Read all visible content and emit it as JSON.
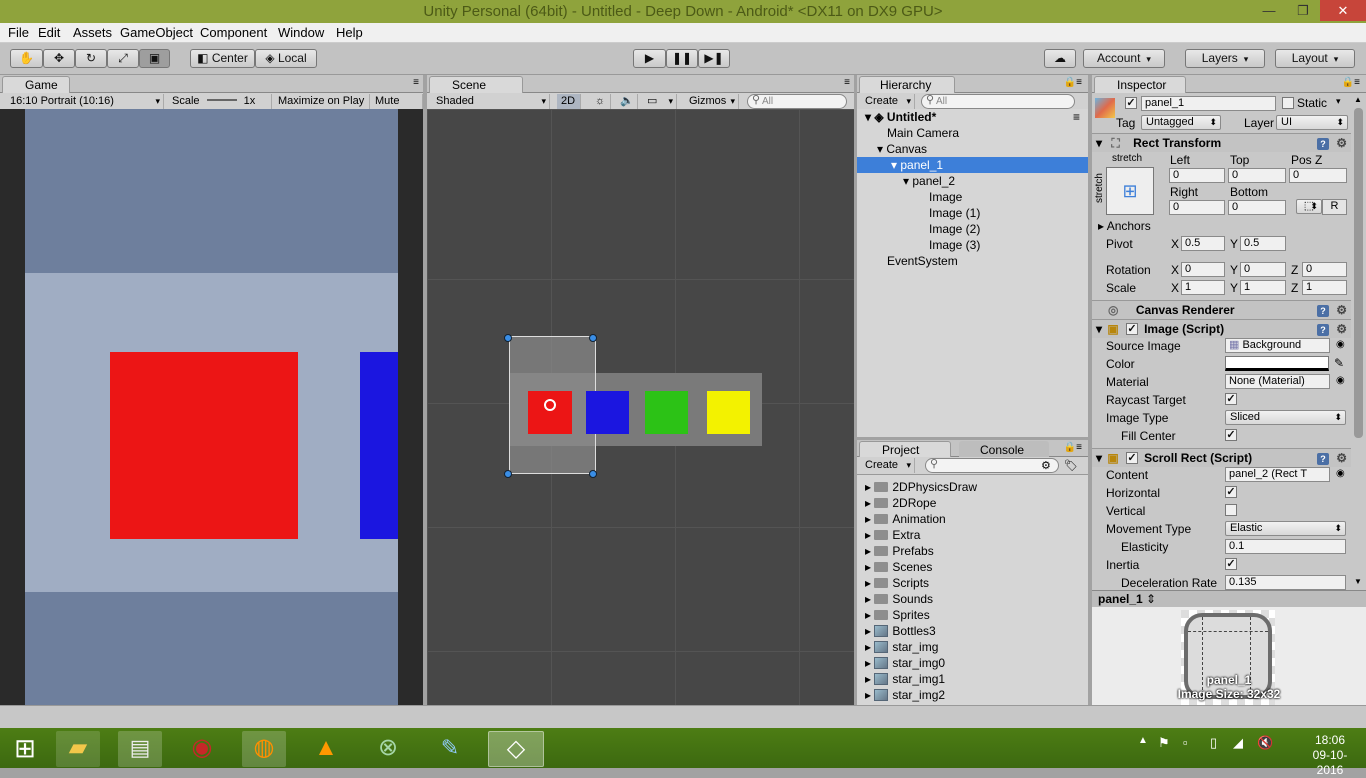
{
  "window": {
    "title": "Unity Personal (64bit) - Untitled - Deep Down - Android* <DX11 on DX9 GPU>",
    "minimize": "—",
    "restore": "❐",
    "close": "✕"
  },
  "menu": [
    "File",
    "Edit",
    "Assets",
    "GameObject",
    "Component",
    "Window",
    "Help"
  ],
  "toolbar": {
    "center": "Center",
    "local": "Local",
    "account": "Account",
    "layers": "Layers",
    "layout": "Layout"
  },
  "game": {
    "tab": "Game",
    "aspect": "16:10 Portrait (10:16)",
    "scale_label": "Scale",
    "scale_value": "1x",
    "maximize": "Maximize on Play",
    "mute": "Mute aud"
  },
  "scene": {
    "tab": "Scene",
    "shading": "Shaded",
    "mode_2d": "2D",
    "gizmos": "Gizmos",
    "search_placeholder": "All"
  },
  "hierarchy": {
    "tab": "Hierarchy",
    "create": "Create",
    "search_placeholder": "All",
    "scene_name": "Untitled*",
    "items": [
      {
        "label": "Main Camera",
        "indent": 0
      },
      {
        "label": "Canvas",
        "indent": 0
      },
      {
        "label": "panel_1",
        "indent": 1,
        "selected": true
      },
      {
        "label": "panel_2",
        "indent": 2
      },
      {
        "label": "Image",
        "indent": 3
      },
      {
        "label": "Image (1)",
        "indent": 3
      },
      {
        "label": "Image (2)",
        "indent": 3
      },
      {
        "label": "Image (3)",
        "indent": 3
      },
      {
        "label": "EventSystem",
        "indent": 0
      }
    ]
  },
  "project": {
    "tab": "Project",
    "console_tab": "Console",
    "create": "Create",
    "folders": [
      "2DPhysicsDraw",
      "2DRope",
      "Animation",
      "Extra",
      "Prefabs",
      "Scenes",
      "Scripts",
      "Sounds",
      "Sprites"
    ],
    "assets": [
      "Bottles3",
      "star_img",
      "star_img0",
      "star_img1",
      "star_img2"
    ]
  },
  "inspector": {
    "tab": "Inspector",
    "object_name": "panel_1",
    "static_label": "Static",
    "tag_label": "Tag",
    "tag_value": "Untagged",
    "layer_label": "Layer",
    "layer_value": "UI",
    "rect_transform": {
      "title": "Rect Transform",
      "stretch": "stretch",
      "left_label": "Left",
      "top_label": "Top",
      "posz_label": "Pos Z",
      "left": "0",
      "top": "0",
      "posz": "0",
      "right_label": "Right",
      "bottom_label": "Bottom",
      "right": "0",
      "bottom": "0",
      "r_button": "R",
      "anchors": "Anchors",
      "pivot_label": "Pivot",
      "pivot_x": "0.5",
      "pivot_y": "0.5",
      "rotation_label": "Rotation",
      "rot_x": "0",
      "rot_y": "0",
      "rot_z": "0",
      "scale_label": "Scale",
      "scale_x": "1",
      "scale_y": "1",
      "scale_z": "1"
    },
    "canvas_renderer": "Canvas Renderer",
    "image": {
      "title": "Image (Script)",
      "source_label": "Source Image",
      "source_value": "Background",
      "color_label": "Color",
      "material_label": "Material",
      "material_value": "None (Material)",
      "raycast_label": "Raycast Target",
      "type_label": "Image Type",
      "type_value": "Sliced",
      "fill_label": "Fill Center"
    },
    "scroll_rect": {
      "title": "Scroll Rect (Script)",
      "content_label": "Content",
      "content_value": "panel_2 (Rect T",
      "horizontal_label": "Horizontal",
      "vertical_label": "Vertical",
      "movement_label": "Movement Type",
      "movement_value": "Elastic",
      "elasticity_label": "Elasticity",
      "elasticity_value": "0.1",
      "inertia_label": "Inertia",
      "decel_label": "Deceleration Rate",
      "decel_value": "0.135"
    }
  },
  "preview": {
    "name": "panel_1",
    "caption_name": "panel_1",
    "caption_size": "Image Size: 32x32"
  },
  "taskbar": {
    "time": "18:06",
    "date": "09-10-2016"
  },
  "colors": {
    "titlebar": "#8fa33c",
    "selection": "#3d7fd9",
    "red": "#ec1515",
    "blue": "#1b16e0",
    "green": "#2cc216",
    "yellow": "#f3f200"
  }
}
